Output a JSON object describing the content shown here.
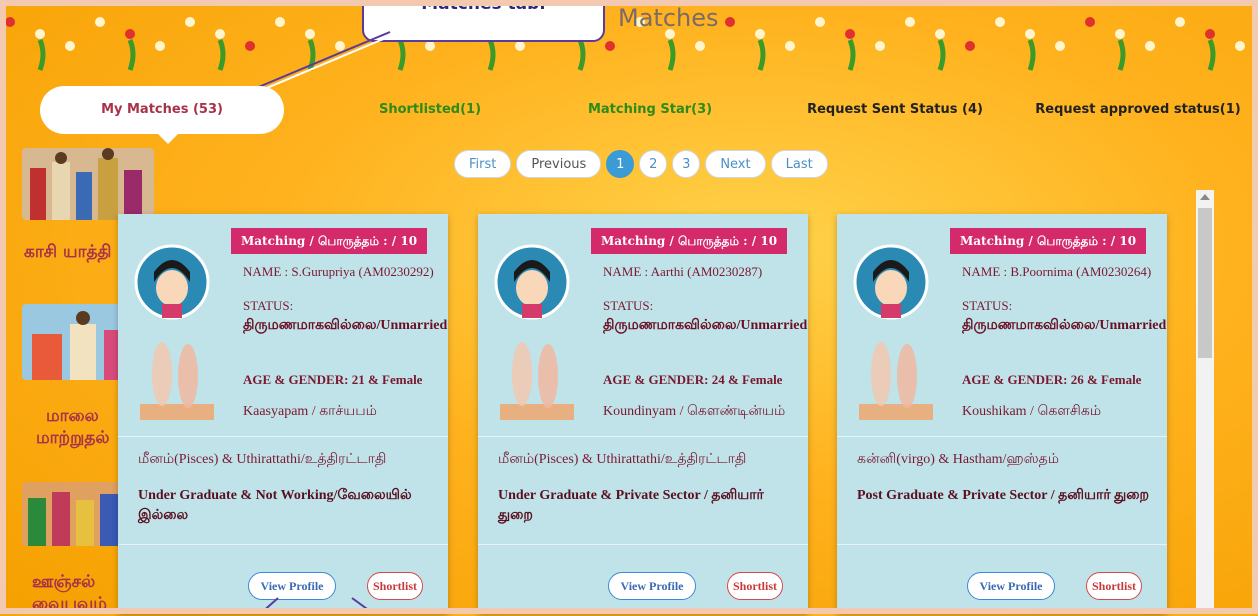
{
  "page": {
    "title": "Matches"
  },
  "callout": {
    "text": "Matches tab."
  },
  "tabs": [
    {
      "label": "My Matches (53)",
      "color": "#a8324a"
    },
    {
      "label": "Shortlisted(1)",
      "color": "#2e8b1a"
    },
    {
      "label": "Matching Star(3)",
      "color": "#2e8b1a"
    },
    {
      "label": "Request Sent Status (4)",
      "color": "#222222"
    },
    {
      "label": "Request approved status(1)",
      "color": "#222222"
    }
  ],
  "pager": {
    "first": "First",
    "previous": "Previous",
    "pages": [
      "1",
      "2",
      "3"
    ],
    "next": "Next",
    "last": "Last"
  },
  "sidebar": {
    "items": [
      {
        "label": "காசி யாத்தி"
      },
      {
        "label": "மாலை",
        "label2": "மாற்றுதல்"
      },
      {
        "label": "ஊஞ்சல்",
        "label2": "வைபவம்"
      }
    ]
  },
  "card_common": {
    "badge": "Matching / பொருத்தம் : / 10",
    "status_label": "STATUS:",
    "status_value": "திருமணமாகவில்லை/Unmarried",
    "age_label": "AGE & GENDER:",
    "view_profile": "View Profile",
    "shortlist": "Shortlist"
  },
  "cards": [
    {
      "name": "NAME : S.Gurupriya (AM0230292)",
      "age": "21 & Female",
      "gothra": "Kaasyapam / காச்யபம்",
      "star": "மீனம்(Pisces) & Uthirattathi/உத்திரட்டாதி",
      "education": "Under Graduate & Not Working/வேலையில் இல்லை"
    },
    {
      "name": "NAME : Aarthi (AM0230287)",
      "age": "24 & Female",
      "gothra": "Koundinyam / கௌண்டின்யம்",
      "star": "மீனம்(Pisces) & Uthirattathi/உத்திரட்டாதி",
      "education": "Under Graduate & Private Sector / தனியார் துறை"
    },
    {
      "name": "NAME : B.Poornima (AM0230264)",
      "age": "26 & Female",
      "gothra": "Koushikam / கௌசிகம்",
      "star": "கன்னி(virgo) & Hastham/ஹஸ்தம்",
      "education": "Post Graduate & Private Sector / தனியார் துறை"
    }
  ],
  "colors": {
    "accent": "#d42a6c",
    "card_bg": "#bfe3e8",
    "background": "#ffb21e",
    "page_active": "#3a9bd5"
  }
}
